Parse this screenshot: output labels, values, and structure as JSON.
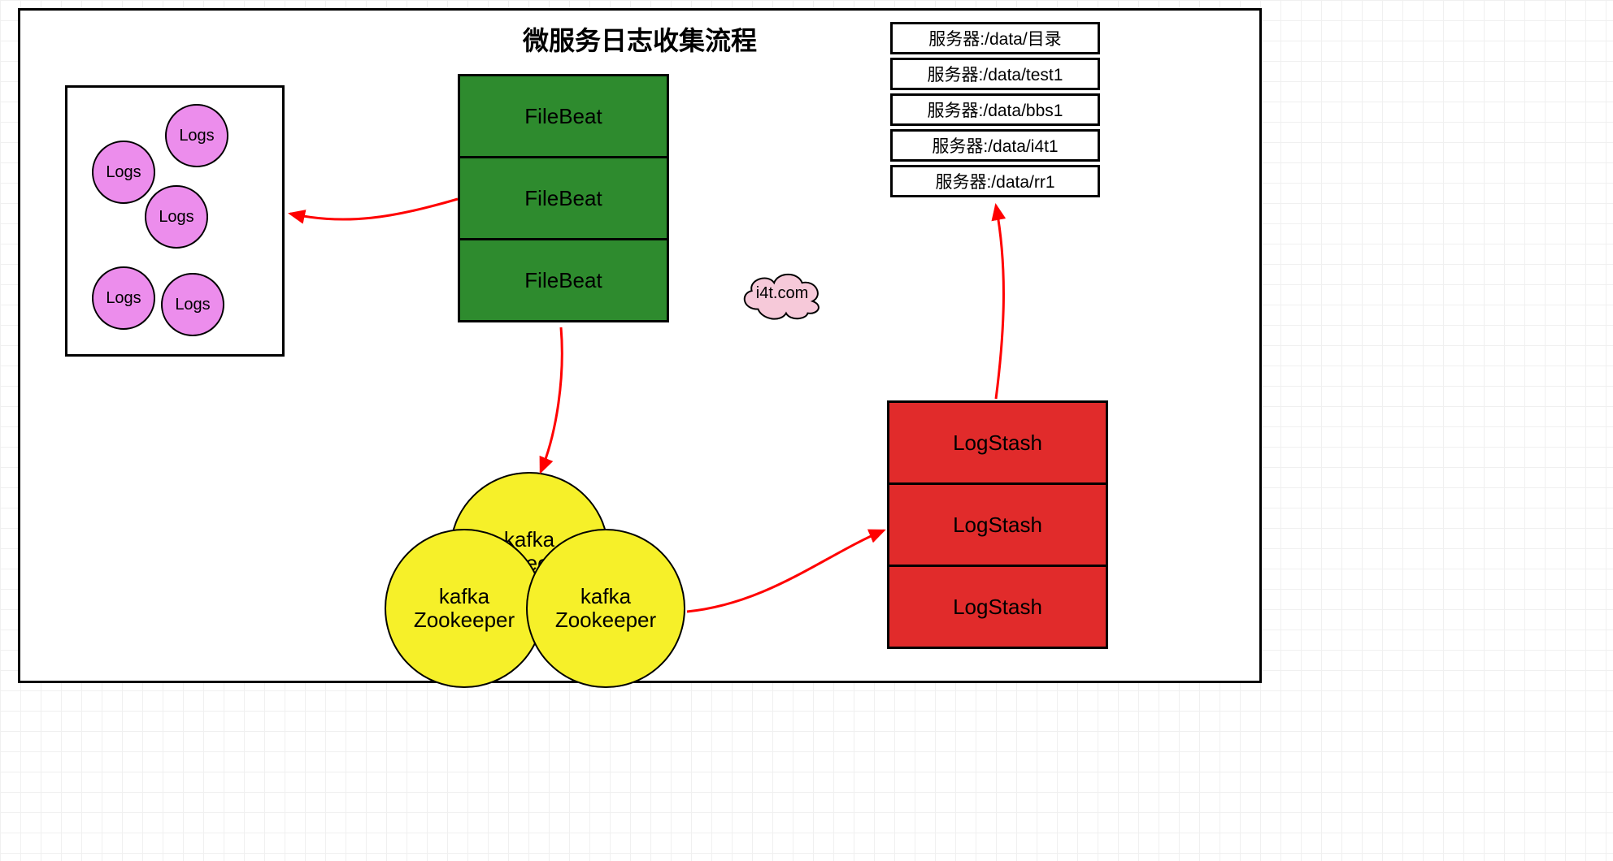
{
  "title": "微服务日志收集流程",
  "colors": {
    "green": "#2e8b2e",
    "red": "#e12b2b",
    "yellow": "#f6f029",
    "magenta": "#ec8dec",
    "pink": "#f6c9d9",
    "arrow": "#ff0000"
  },
  "logs": {
    "items": [
      "Logs",
      "Logs",
      "Logs",
      "Logs",
      "Logs"
    ]
  },
  "filebeat": {
    "items": [
      "FileBeat",
      "FileBeat",
      "FileBeat"
    ]
  },
  "cloud": {
    "label": "i4t.com"
  },
  "servers": {
    "items": [
      "服务器:/data/目录",
      "服务器:/data/test1",
      "服务器:/data/bbs1",
      "服务器:/data/i4t1",
      "服务器:/data/rr1"
    ]
  },
  "logstash": {
    "items": [
      "LogStash",
      "LogStash",
      "LogStash"
    ]
  },
  "kafka": {
    "items": [
      {
        "line1": "kafka",
        "line2": "Zookeeper"
      },
      {
        "line1": "kafka",
        "line2": "Zookeeper"
      },
      {
        "line1": "kafka",
        "line2": "Zookeeper"
      }
    ]
  }
}
